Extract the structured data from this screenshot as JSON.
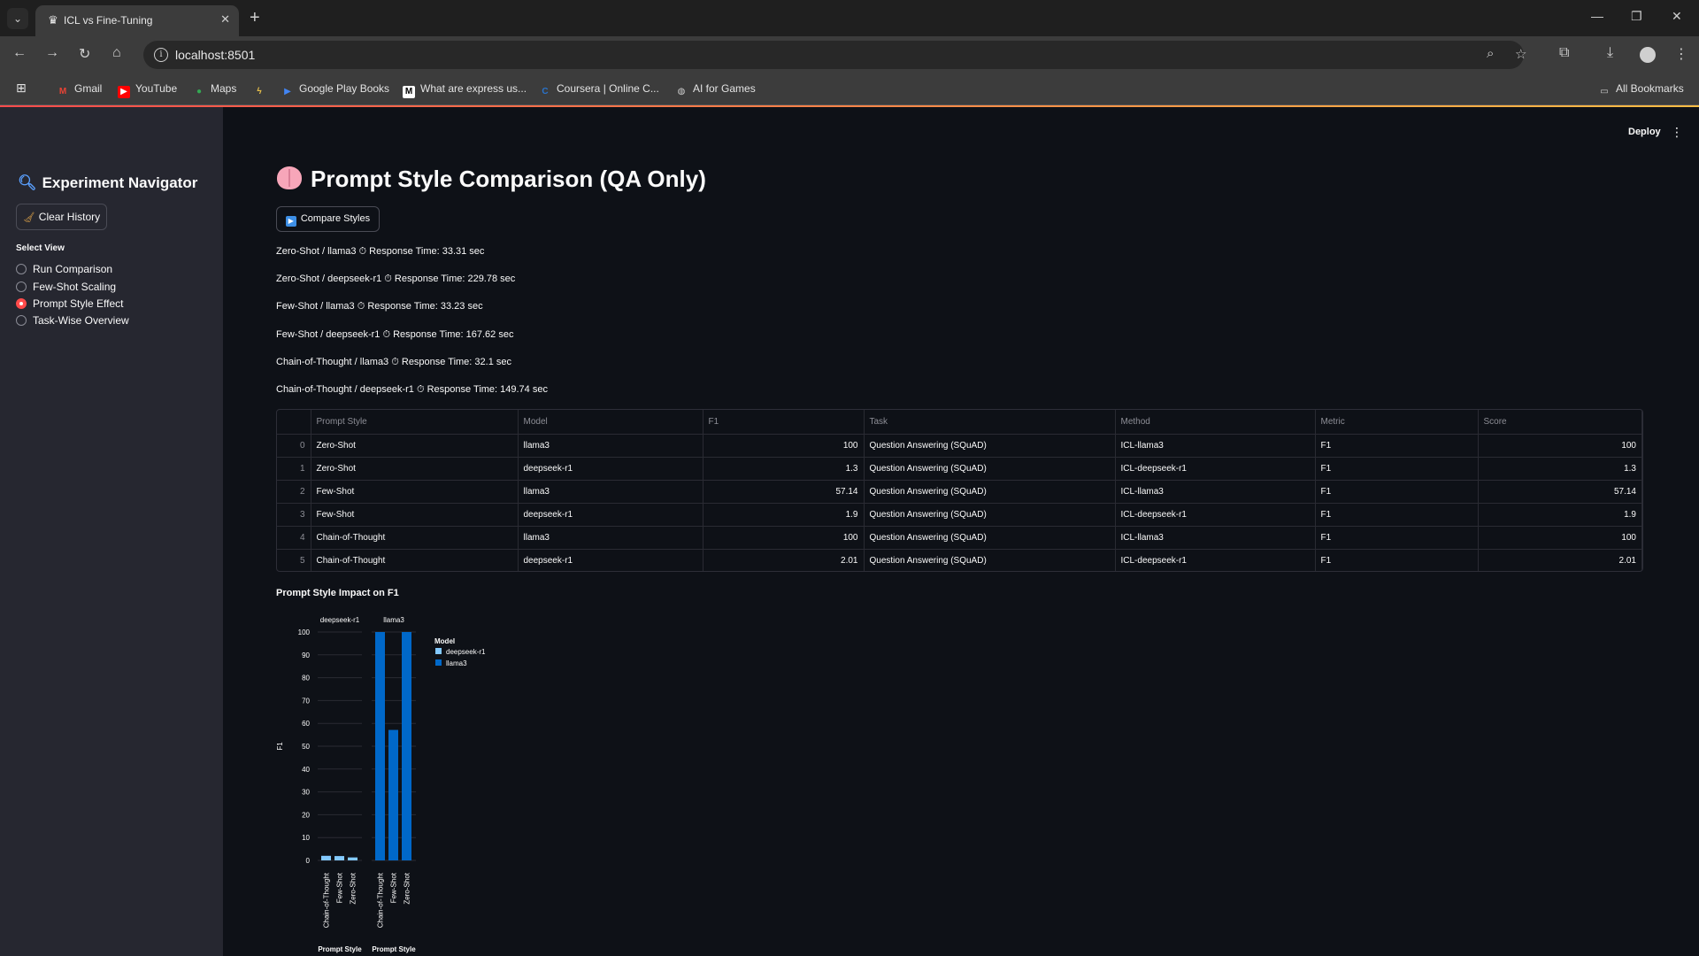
{
  "browser": {
    "tab_title": "ICL vs Fine-Tuning",
    "url": "localhost:8501",
    "bookmarks": [
      "Gmail",
      "YouTube",
      "Maps",
      "Google Play Books",
      "What are express us...",
      "Coursera | Online C...",
      "AI for Games"
    ],
    "all_bookmarks": "All Bookmarks"
  },
  "header": {
    "deploy": "Deploy"
  },
  "sidebar": {
    "title": "Experiment Navigator",
    "clear_history": "Clear History",
    "select_view_label": "Select View",
    "views": [
      "Run Comparison",
      "Few-Shot Scaling",
      "Prompt Style Effect",
      "Task-Wise Overview"
    ],
    "selected_view": "Prompt Style Effect"
  },
  "main": {
    "title": "Prompt Style Comparison (QA Only)",
    "compare_button": "Compare Styles",
    "response_times": [
      "Zero-Shot / llama3 ⏱ Response Time: 33.31 sec",
      "Zero-Shot / deepseek-r1 ⏱ Response Time: 229.78 sec",
      "Few-Shot / llama3 ⏱ Response Time: 33.23 sec",
      "Few-Shot / deepseek-r1 ⏱ Response Time: 167.62 sec",
      "Chain-of-Thought / llama3 ⏱ Response Time: 32.1 sec",
      "Chain-of-Thought / deepseek-r1 ⏱ Response Time: 149.74 sec"
    ],
    "table": {
      "columns": [
        "",
        "Prompt Style",
        "Model",
        "F1",
        "Task",
        "Method",
        "Metric",
        "Score"
      ],
      "rows": [
        [
          "0",
          "Zero-Shot",
          "llama3",
          "100",
          "Question Answering (SQuAD)",
          "ICL-llama3",
          "F1",
          "100"
        ],
        [
          "1",
          "Zero-Shot",
          "deepseek-r1",
          "1.3",
          "Question Answering (SQuAD)",
          "ICL-deepseek-r1",
          "F1",
          "1.3"
        ],
        [
          "2",
          "Few-Shot",
          "llama3",
          "57.14",
          "Question Answering (SQuAD)",
          "ICL-llama3",
          "F1",
          "57.14"
        ],
        [
          "3",
          "Few-Shot",
          "deepseek-r1",
          "1.9",
          "Question Answering (SQuAD)",
          "ICL-deepseek-r1",
          "F1",
          "1.9"
        ],
        [
          "4",
          "Chain-of-Thought",
          "llama3",
          "100",
          "Question Answering (SQuAD)",
          "ICL-llama3",
          "F1",
          "100"
        ],
        [
          "5",
          "Chain-of-Thought",
          "deepseek-r1",
          "2.01",
          "Question Answering (SQuAD)",
          "ICL-deepseek-r1",
          "F1",
          "2.01"
        ]
      ]
    },
    "chart_title": "Prompt Style Impact on F1"
  },
  "chart_data": {
    "type": "bar",
    "title": "Prompt Style Impact on F1",
    "ylabel": "F1",
    "xlabel": "Prompt Style",
    "ylim": [
      0,
      100
    ],
    "yticks": [
      0,
      10,
      20,
      30,
      40,
      50,
      60,
      70,
      80,
      90,
      100
    ],
    "facets": [
      "deepseek-r1",
      "llama3"
    ],
    "categories": [
      "Chain-of-Thought",
      "Few-Shot",
      "Zero-Shot"
    ],
    "series": [
      {
        "name": "deepseek-r1",
        "values": [
          2.01,
          1.9,
          1.3
        ],
        "color": "#83c9ff"
      },
      {
        "name": "llama3",
        "values": [
          100,
          57.14,
          100
        ],
        "color": "#0068c9"
      }
    ],
    "legend_title": "Model",
    "legend_position": "right",
    "grid": true
  }
}
